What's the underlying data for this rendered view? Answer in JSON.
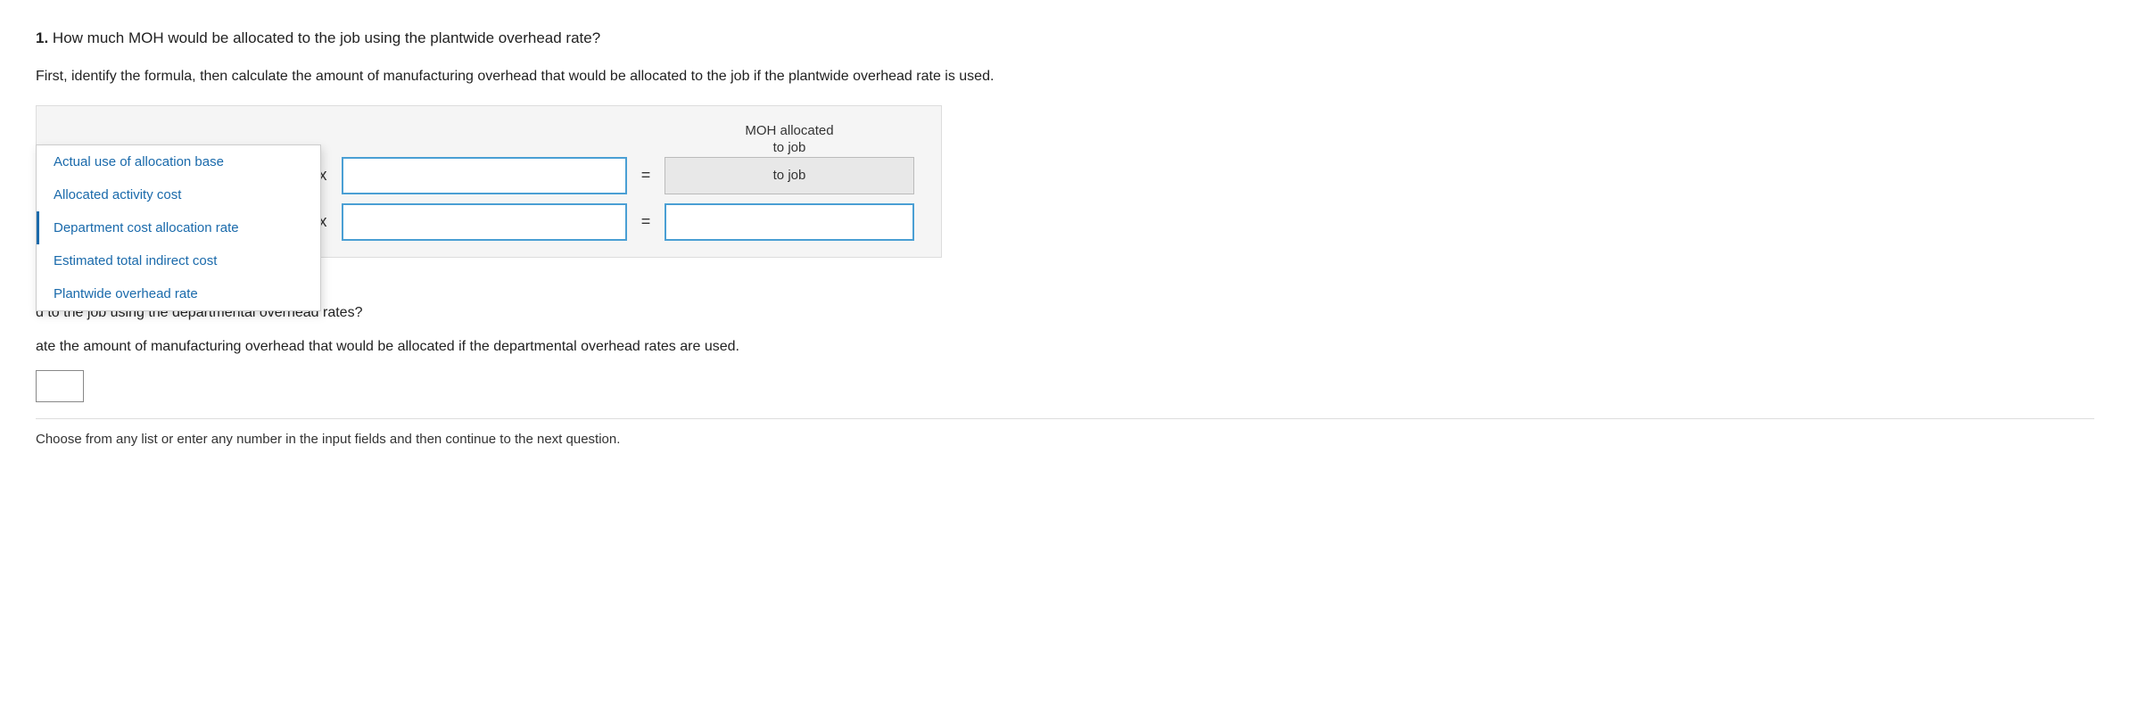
{
  "question1": {
    "number": "1.",
    "text": "How much MOH would be allocated to the job using the plantwide overhead rate?",
    "sub_text": "First, identify the formula, then calculate the amount of manufacturing overhead that would be allocated to the job if the plantwide overhead rate is used.",
    "moh_header_line1": "MOH allocated",
    "moh_header_line2": "to job",
    "operator1": "x",
    "operator2": "x",
    "equals1": "=",
    "equals2": "=",
    "dropdown_placeholder": "",
    "input1_value": "",
    "input2_value": "",
    "result_input_value": ""
  },
  "dropdown_items": [
    {
      "label": "Actual use of allocation base",
      "id": "actual-use"
    },
    {
      "label": "Allocated activity cost",
      "id": "allocated-activity"
    },
    {
      "label": "Department cost allocation rate",
      "id": "dept-cost",
      "highlighted": true
    },
    {
      "label": "Estimated total indirect cost",
      "id": "estimated-indirect"
    },
    {
      "label": "Plantwide overhead rate",
      "id": "plantwide-rate"
    }
  ],
  "question2": {
    "text_part1": "d to the job using the departmental overhead rates?",
    "sub_text": "ate the amount of manufacturing overhead that would be allocated if the departmental overhead rates are used."
  },
  "footer": {
    "text": "Choose from any list or enter any number in the input fields and then continue to the next question."
  }
}
